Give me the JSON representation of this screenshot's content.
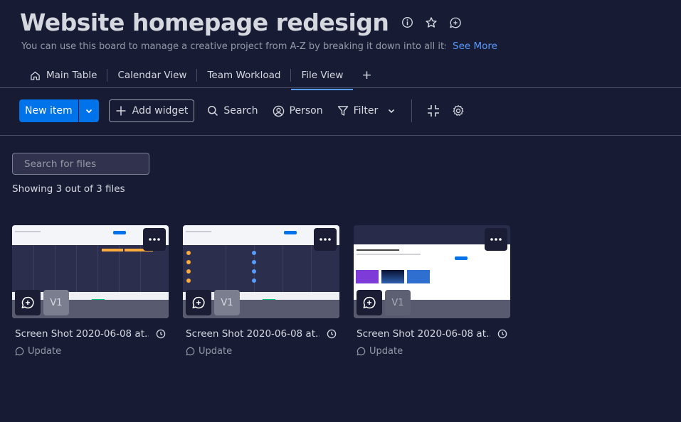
{
  "board": {
    "title": "Website homepage redesign",
    "description": "You can use this board to manage a creative project from A-Z by breaking it down into all its ...",
    "see_more": "See More"
  },
  "tabs": [
    {
      "label": "Main Table",
      "icon": "home-icon",
      "active": false
    },
    {
      "label": "Calendar View",
      "active": false
    },
    {
      "label": "Team Workload",
      "active": false
    },
    {
      "label": "File View",
      "active": true
    }
  ],
  "tab_add": "+",
  "toolbar": {
    "new_item": "New item",
    "add_widget": "Add widget",
    "search": "Search",
    "person": "Person",
    "filter": "Filter"
  },
  "files": {
    "search_placeholder": "Search for files",
    "showing": "Showing 3 out of 3 files",
    "items": [
      {
        "name": "Screen Shot 2020-06-08 at...",
        "version": "V1",
        "update": "Update"
      },
      {
        "name": "Screen Shot 2020-06-08 at...",
        "version": "V1",
        "update": "Update"
      },
      {
        "name": "Screen Shot 2020-06-08 at...",
        "version": "V1",
        "update": "Update"
      }
    ]
  },
  "colors": {
    "background": "#181b34",
    "primary": "#0073ea",
    "link": "#579bfc"
  }
}
